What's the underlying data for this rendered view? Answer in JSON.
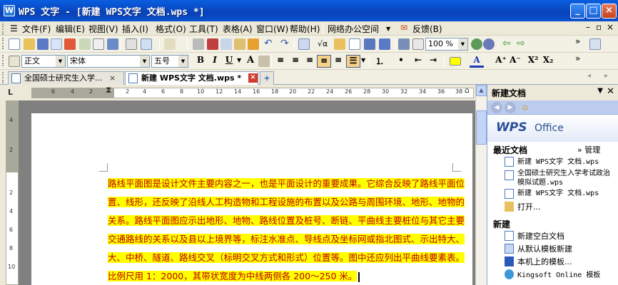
{
  "window": {
    "title": "WPS 文字 - [新建 WPS文字 文档.wps *]",
    "app_icon": "W"
  },
  "menu": [
    "文件(F)",
    "编辑(E)",
    "视图(V)",
    "插入(I)",
    "格式(O)",
    "工具(T)",
    "表格(A)",
    "窗口(W)",
    "帮助(H)",
    "网络办公空间",
    "反馈(B)"
  ],
  "toolbar2": {
    "style": "正文",
    "font": "宋体",
    "size": "五号",
    "bold": "B",
    "italic": "I",
    "underline": "U",
    "font_color": "A"
  },
  "toolbar1": {
    "zoom": "100 %"
  },
  "tabs": [
    {
      "label": "全国硕士研究生入学...",
      "close": "×"
    },
    {
      "label": "新建 WPS文字 文档.wps *",
      "close": "×"
    }
  ],
  "new_tab_symbol": "+",
  "ruler_numbers": [
    "L",
    "6",
    "4",
    "2",
    "2",
    "4",
    "6",
    "8",
    "10",
    "12",
    "14",
    "16",
    "18",
    "20",
    "22",
    "24",
    "26",
    "28",
    "30",
    "32",
    "34",
    "36",
    "38"
  ],
  "vruler_numbers": [
    "4",
    "2",
    "2",
    "4",
    "6",
    "8",
    "10"
  ],
  "document": {
    "paragraph_lines": [
      "路线平面图是设计文件主要内容之一，也是平面设计的重要成果。它综合反映了路线平面位",
      "置、线形，还反映了沿线人工构造物和工程设施的布置以及公路与周围环境、地形、地物的",
      "关系。路线平面图应示出地形、地物、路线位置及桩号、断链、平曲线主要桩位与其它主要",
      "交通路线的关系以及县以上境界等，标注水准点、导线点及坐标网或指北图式、示出特大、",
      "大、中桥、隧道、路线交叉（标明交叉方式和形式）位置等。图中还应列出平曲线要素表。",
      "比例尺用 1：2000，其带状宽度为中线两侧各 200～250 米。"
    ],
    "text_color": "#c00000",
    "highlight_color": "#ffff00"
  },
  "task_pane": {
    "title": "新建文档",
    "brand_wps": "WPS",
    "brand_office": "Office",
    "recent_title": "最近文档",
    "manage": "» 管理",
    "recent": [
      "新建 WPS文字 文档.wps",
      "全国硕士研究生入学考试政治模拟试题.wps",
      "新建 WPS文字 文档.wps",
      "打开..."
    ],
    "new_title": "新建",
    "new_items": [
      "新建空白文档",
      "从默认模板新建",
      "本机上的模板...",
      "Kingsoft Online 模板"
    ]
  }
}
